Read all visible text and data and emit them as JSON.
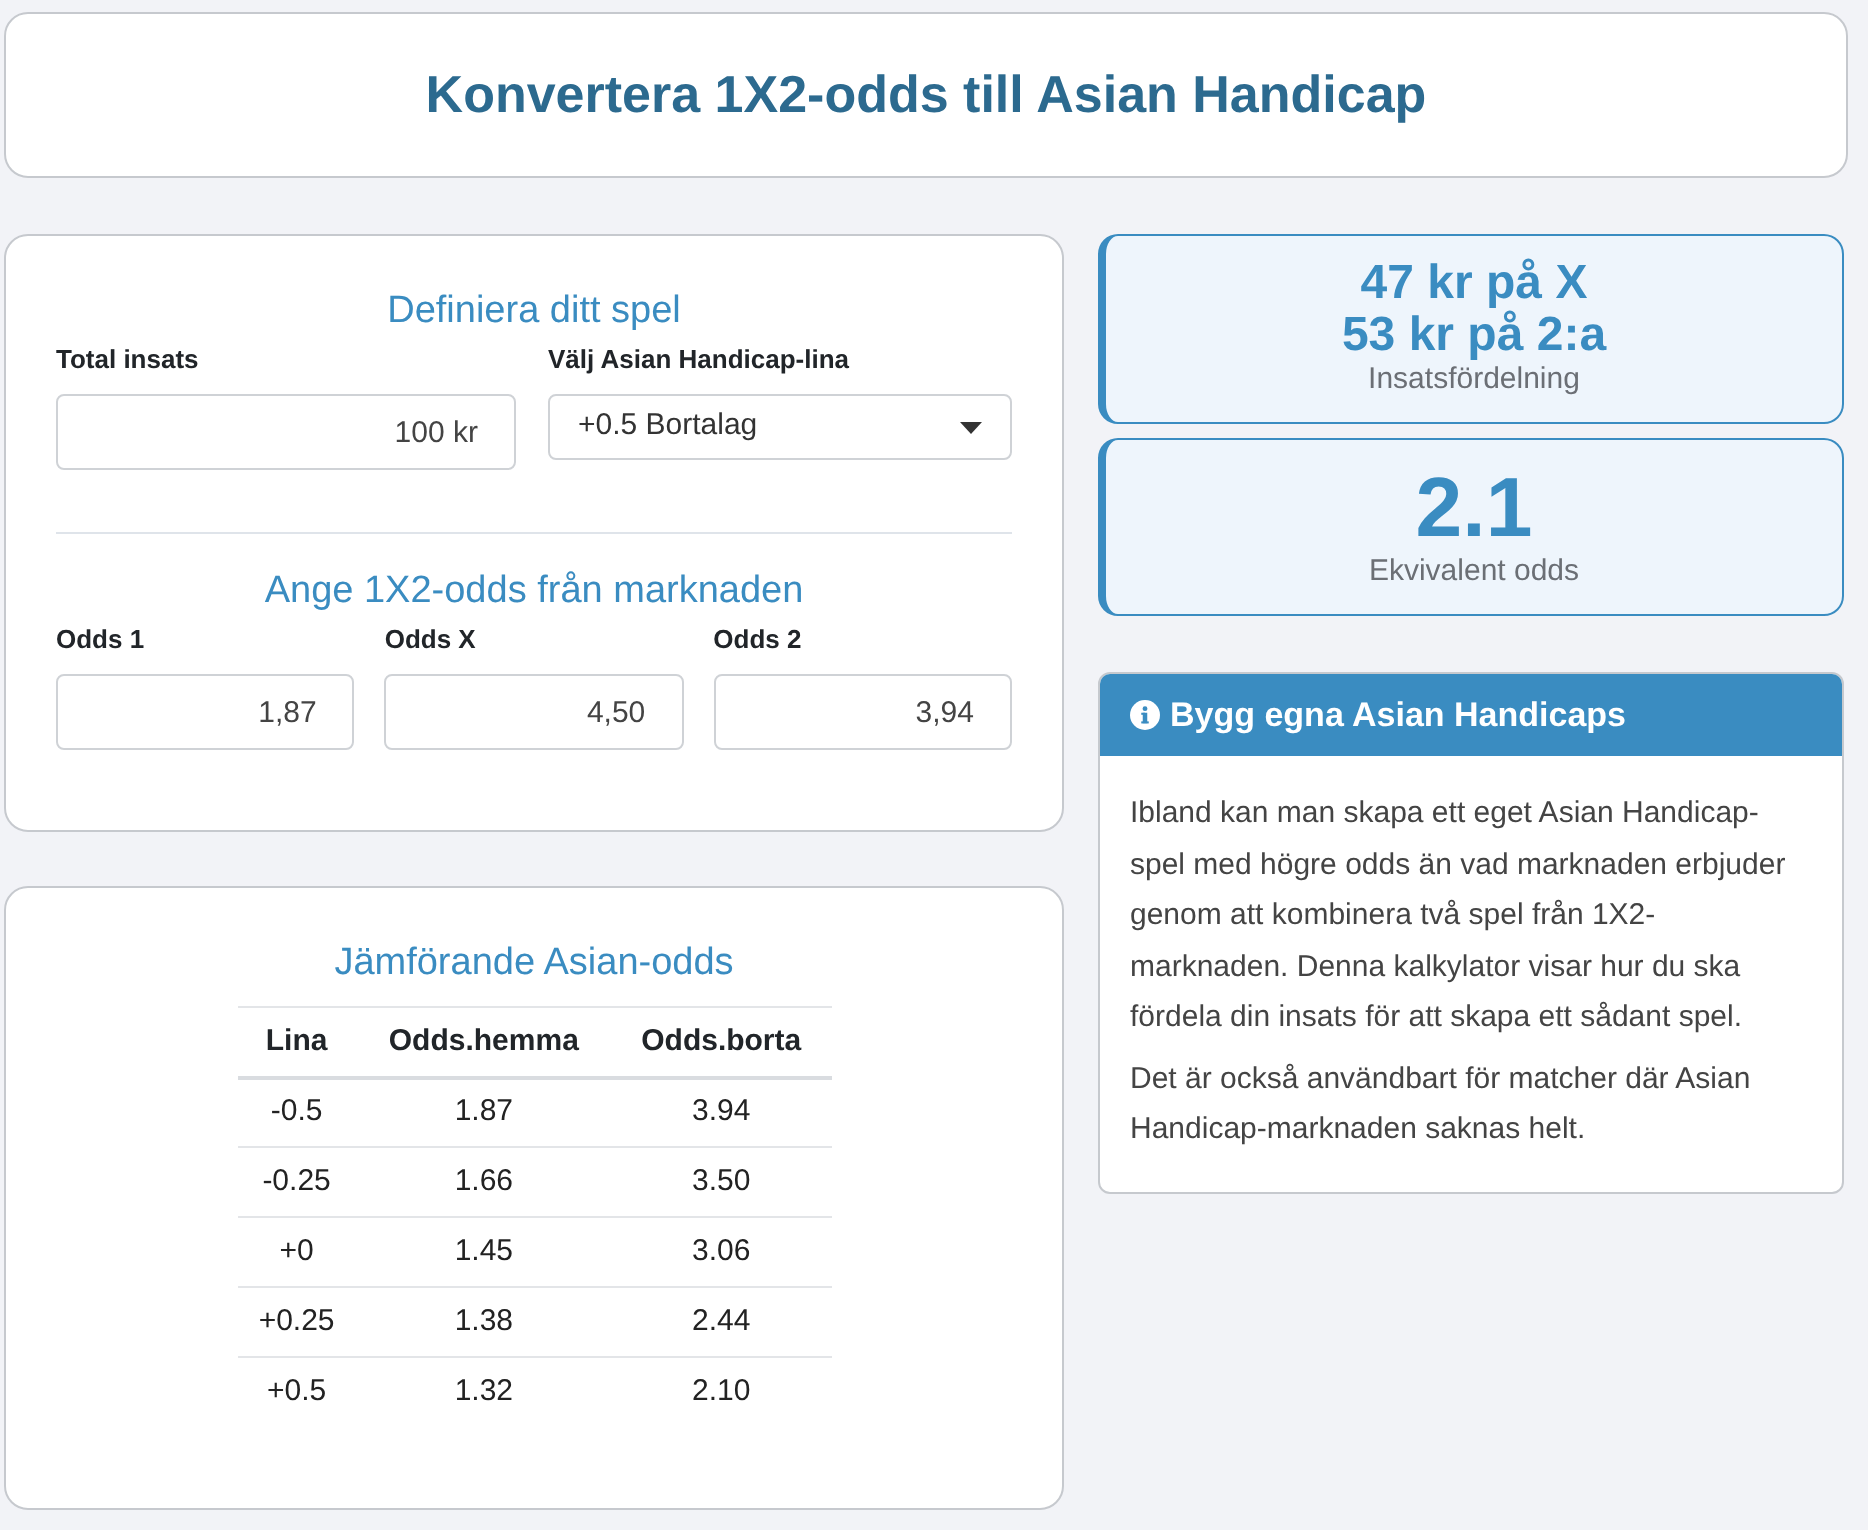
{
  "page_title": "Konvertera 1X2-odds till Asian Handicap",
  "bet_form": {
    "title": "Definiera ditt spel",
    "stake": {
      "label": "Total insats",
      "value": "100 kr"
    },
    "line_select": {
      "label": "Välj Asian Handicap-lina",
      "value": "+0.5 Bortalag"
    }
  },
  "odds_form": {
    "title": "Ange 1X2-odds från marknaden",
    "fields": [
      {
        "label": "Odds 1",
        "value": "1,87"
      },
      {
        "label": "Odds X",
        "value": "4,50"
      },
      {
        "label": "Odds 2",
        "value": "3,94"
      }
    ]
  },
  "comparison": {
    "title": "Jämförande Asian-odds",
    "columns": [
      "Lina",
      "Odds.hemma",
      "Odds.borta"
    ],
    "rows": [
      [
        "-0.5",
        "1.87",
        "3.94"
      ],
      [
        "-0.25",
        "1.66",
        "3.50"
      ],
      [
        "+0",
        "1.45",
        "3.06"
      ],
      [
        "+0.25",
        "1.38",
        "2.44"
      ],
      [
        "+0.5",
        "1.32",
        "2.10"
      ]
    ]
  },
  "results": [
    {
      "lines": [
        "47 kr på X",
        "53 kr på 2:a"
      ],
      "caption": "Insatsfördelning"
    },
    {
      "lines": [
        "2.1"
      ],
      "caption": "Ekvivalent odds"
    }
  ],
  "info": {
    "title": "Bygg egna Asian Handicaps",
    "paragraphs": [
      "Ibland kan man skapa ett eget Asian Handicap-spel med högre odds än vad marknaden erbjuder genom att kombinera två spel från 1X2-marknaden. Denna kalkylator visar hur du ska fördela din insats för att skapa ett sådant spel.",
      "Det är också användbart för matcher där Asian Handicap-marknaden saknas helt."
    ]
  }
}
